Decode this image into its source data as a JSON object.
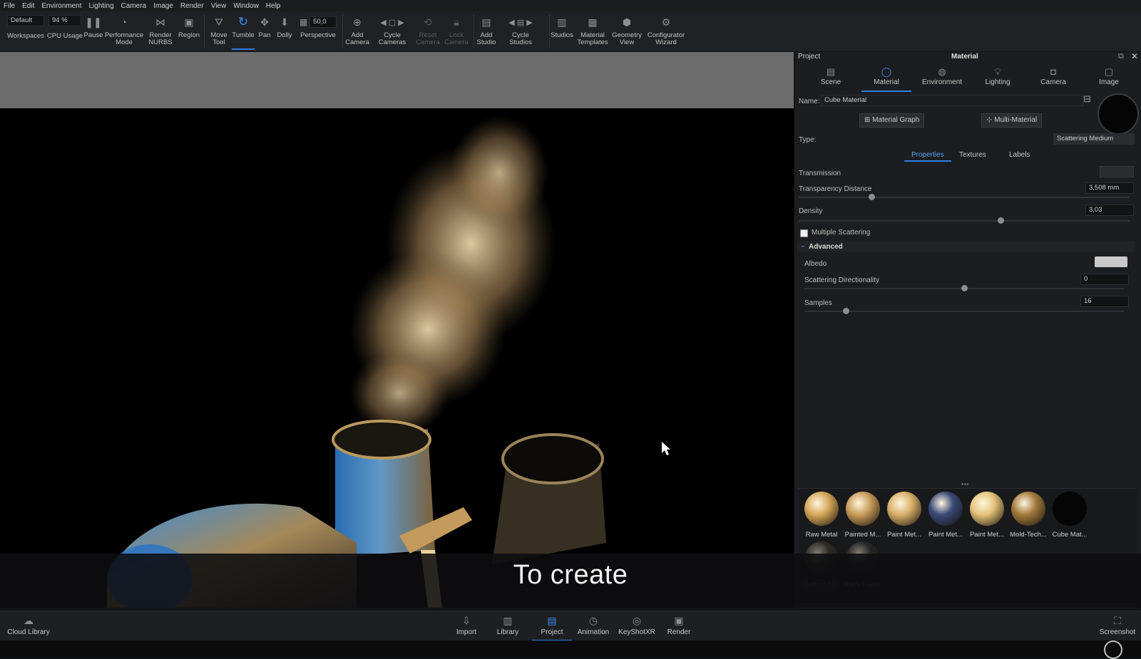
{
  "menu": [
    "File",
    "Edit",
    "Environment",
    "Lighting",
    "Camera",
    "Image",
    "Render",
    "View",
    "Window",
    "Help"
  ],
  "toolbar": {
    "workspace_value": "Default",
    "cpu_value": "94 %",
    "focal_value": "50,0",
    "items": [
      {
        "label": "Workspaces",
        "icon": "workspaces-icon"
      },
      {
        "label": "CPU Usage",
        "icon": "cpu-icon"
      },
      {
        "label": "Pause",
        "icon": "pause-icon"
      },
      {
        "label": "Performance\nMode",
        "icon": "performance-icon"
      },
      {
        "label": "Render\nNURBS",
        "icon": "nurbs-icon"
      },
      {
        "label": "Region",
        "icon": "region-icon"
      },
      {
        "label": "Move\nTool",
        "icon": "move-icon"
      },
      {
        "label": "Tumble",
        "icon": "tumble-icon"
      },
      {
        "label": "Pan",
        "icon": "pan-icon"
      },
      {
        "label": "Dolly",
        "icon": "dolly-icon"
      },
      {
        "label": "Perspective",
        "icon": "perspective-icon"
      },
      {
        "label": "Add\nCamera",
        "icon": "add-camera-icon"
      },
      {
        "label": "Cycle\nCameras",
        "icon": "cycle-cameras-icon"
      },
      {
        "label": "Reset\nCamera",
        "icon": "reset-camera-icon"
      },
      {
        "label": "Lock\nCamera",
        "icon": "lock-camera-icon"
      },
      {
        "label": "Add\nStudio",
        "icon": "add-studio-icon"
      },
      {
        "label": "Cycle\nStudios",
        "icon": "cycle-studios-icon"
      },
      {
        "label": "Studios",
        "icon": "studios-icon"
      },
      {
        "label": "Material\nTemplates",
        "icon": "material-templates-icon"
      },
      {
        "label": "Geometry\nView",
        "icon": "geometry-view-icon"
      },
      {
        "label": "Configurator\nWizard",
        "icon": "configurator-icon"
      }
    ]
  },
  "viewport": {
    "subtitle": "To create"
  },
  "panel": {
    "header_left": "Project",
    "header_title": "Material",
    "tabs": [
      "Scene",
      "Material",
      "Environment",
      "Lighting",
      "Camera",
      "Image"
    ],
    "name_label": "Name:",
    "name_value": "Cube Material",
    "material_graph_btn": "Material Graph",
    "multi_material_btn": "Multi-Material",
    "type_label": "Type:",
    "type_value": "Scattering Medium",
    "subtabs": [
      "Properties",
      "Textures",
      "Labels"
    ],
    "transmission_label": "Transmission",
    "transparency_label": "Transparency Distance",
    "transparency_value": "3,508 mm",
    "transparency_level": 0.22,
    "density_label": "Density",
    "density_value": "3,03",
    "density_level": 0.61,
    "multiple_scattering_label": "Multiple Scattering",
    "advanced_label": "Advanced",
    "albedo_label": "Albedo",
    "scatter_dir_label": "Scattering Directionality",
    "scatter_dir_value": "0",
    "scatter_dir_level": 0.5,
    "samples_label": "Samples",
    "samples_value": "16",
    "samples_level": 0.13,
    "thumbnails": [
      {
        "label": "Raw Metal",
        "color": "#d7a85a"
      },
      {
        "label": "Painted M...",
        "color": "#c99c5a"
      },
      {
        "label": "Paint Met...",
        "color": "#d9b06a"
      },
      {
        "label": "Paint Met...",
        "color": "#3a4a78"
      },
      {
        "label": "Paint Met...",
        "color": "#e6c47a"
      },
      {
        "label": "Mold-Tech...",
        "color": "#a37a3c"
      },
      {
        "label": "Cube Mat...",
        "color": "#050505"
      },
      {
        "label": "Carbon Fi...",
        "color": "#4a4336"
      },
      {
        "label": "Black Plastic",
        "color": "#3a3631"
      }
    ]
  },
  "bottombar": {
    "cloud_library": "Cloud Library",
    "items": [
      {
        "label": "Import",
        "icon": "import-icon"
      },
      {
        "label": "Library",
        "icon": "library-icon"
      },
      {
        "label": "Project",
        "icon": "project-icon"
      },
      {
        "label": "Animation",
        "icon": "animation-icon"
      },
      {
        "label": "KeyShotXR",
        "icon": "keyshotxr-icon"
      },
      {
        "label": "Render",
        "icon": "render-icon"
      }
    ],
    "screenshot": "Screenshot"
  }
}
